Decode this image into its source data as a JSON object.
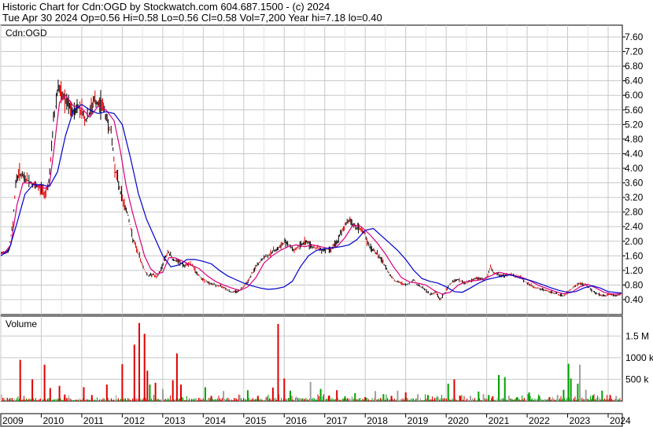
{
  "header": {
    "line1": "Historic Chart for Cdn:OGD by Stockwatch.com 604.687.1500 - (c) 2024",
    "line2": "Tue Apr 30 2024  Op=0.56  Hi=0.58  Lo=0.56  Cl=0.58  Vol=7,200  Year hi=7.18  lo=0.40"
  },
  "colors": {
    "price_black": "#000000",
    "price_red": "#e00000",
    "ma_short": "#d8007f",
    "ma_long": "#0000cc",
    "vol_up": "#00a000",
    "vol_down": "#e00000",
    "vol_flat": "#a0a0a0",
    "grid": "#c8c8c8"
  },
  "chart_data": [
    {
      "type": "line",
      "label": "Cdn:OGD",
      "ylim": [
        0.2,
        7.7
      ],
      "y_ticks": [
        "7.60",
        "7.20",
        "6.80",
        "6.40",
        "6.00",
        "5.60",
        "5.20",
        "4.80",
        "4.40",
        "4.00",
        "3.60",
        "3.20",
        "2.80",
        "2.40",
        "2.00",
        "1.60",
        "1.20",
        "0.80",
        "0.40"
      ],
      "x_ticks": [
        "2009",
        "2010",
        "2011",
        "2012",
        "2013",
        "2014",
        "2015",
        "2016",
        "2017",
        "2018",
        "2019",
        "2020",
        "2021",
        "2022",
        "2023",
        "2024"
      ],
      "x_range": [
        2009.0,
        2024.35
      ],
      "grid": true,
      "series": [
        {
          "name": "",
          "role": "price",
          "x": [
            2009.0,
            2009.08,
            2009.2,
            2009.3,
            2009.37,
            2009.45,
            2009.55,
            2009.7,
            2009.85,
            2010.0,
            2010.1,
            2010.2,
            2010.3,
            2010.42,
            2010.5,
            2010.55,
            2010.6,
            2010.68,
            2010.78,
            2010.9,
            2011.0,
            2011.1,
            2011.2,
            2011.3,
            2011.4,
            2011.5,
            2011.6,
            2011.72,
            2011.82,
            2011.95,
            2012.05,
            2012.15,
            2012.25,
            2012.35,
            2012.45,
            2012.55,
            2012.65,
            2012.75,
            2012.85,
            2012.95,
            2013.05,
            2013.15,
            2013.25,
            2013.35,
            2013.45,
            2013.55,
            2013.65,
            2013.75,
            2013.85,
            2014.0,
            2014.15,
            2014.3,
            2014.5,
            2014.7,
            2014.9,
            2015.1,
            2015.3,
            2015.5,
            2015.65,
            2015.75,
            2015.85,
            2015.95,
            2016.05,
            2016.15,
            2016.25,
            2016.4,
            2016.55,
            2016.7,
            2016.85,
            2017.0,
            2017.15,
            2017.3,
            2017.45,
            2017.6,
            2017.75,
            2017.9,
            2018.0,
            2018.05,
            2018.15,
            2018.3,
            2018.45,
            2018.6,
            2018.75,
            2018.9,
            2019.0,
            2019.1,
            2019.2,
            2019.3,
            2019.45,
            2019.6,
            2019.75,
            2019.85,
            2019.95,
            2020.05,
            2020.15,
            2020.3,
            2020.45,
            2020.6,
            2020.75,
            2020.9,
            2021.0,
            2021.1,
            2021.15,
            2021.25,
            2021.4,
            2021.55,
            2021.7,
            2021.85,
            2022.0,
            2022.15,
            2022.3,
            2022.45,
            2022.6,
            2022.75,
            2022.9,
            2023.0,
            2023.15,
            2023.3,
            2023.45,
            2023.6,
            2023.75,
            2023.9,
            2024.05,
            2024.2,
            2024.33
          ],
          "values": [
            1.65,
            1.7,
            1.75,
            2.5,
            3.6,
            3.9,
            3.75,
            3.65,
            3.5,
            3.45,
            3.3,
            3.7,
            5.3,
            6.3,
            5.9,
            6.0,
            5.8,
            5.7,
            5.5,
            5.7,
            5.6,
            5.3,
            5.5,
            5.9,
            5.7,
            5.8,
            5.4,
            5.0,
            4.0,
            3.4,
            3.0,
            2.7,
            2.1,
            1.8,
            1.5,
            1.2,
            1.05,
            1.1,
            1.0,
            1.2,
            1.55,
            1.7,
            1.5,
            1.45,
            1.4,
            1.3,
            1.4,
            1.3,
            1.1,
            0.95,
            0.85,
            0.8,
            0.75,
            0.6,
            0.65,
            0.9,
            1.3,
            1.55,
            1.65,
            1.75,
            1.8,
            1.9,
            2.0,
            1.85,
            1.75,
            1.9,
            2.0,
            1.85,
            1.8,
            1.75,
            1.8,
            1.95,
            2.35,
            2.6,
            2.4,
            2.3,
            2.2,
            1.95,
            1.8,
            1.65,
            1.4,
            1.1,
            0.9,
            0.85,
            0.8,
            0.85,
            0.95,
            0.8,
            0.7,
            0.55,
            0.6,
            0.4,
            0.55,
            0.75,
            0.9,
            0.95,
            0.85,
            0.9,
            1.0,
            0.95,
            1.0,
            1.3,
            1.15,
            1.1,
            1.05,
            1.1,
            1.05,
            1.0,
            0.85,
            0.75,
            0.7,
            0.65,
            0.6,
            0.55,
            0.5,
            0.6,
            0.75,
            0.85,
            0.8,
            0.65,
            0.55,
            0.5,
            0.55,
            0.5,
            0.58
          ]
        },
        {
          "name": "",
          "role": "short-ma",
          "x": [
            2009.0,
            2009.1,
            2009.25,
            2009.4,
            2009.55,
            2009.75,
            2009.95,
            2010.1,
            2010.2,
            2010.3,
            2010.45,
            2010.6,
            2010.8,
            2011.0,
            2011.2,
            2011.4,
            2011.6,
            2011.8,
            2011.95,
            2012.1,
            2012.25,
            2012.4,
            2012.55,
            2012.7,
            2012.85,
            2013.0,
            2013.15,
            2013.3,
            2013.5,
            2013.7,
            2013.9,
            2014.1,
            2014.3,
            2014.5,
            2014.7,
            2014.9,
            2015.1,
            2015.3,
            2015.5,
            2015.7,
            2015.9,
            2016.1,
            2016.3,
            2016.5,
            2016.7,
            2016.9,
            2017.1,
            2017.3,
            2017.5,
            2017.7,
            2017.9,
            2018.1,
            2018.3,
            2018.5,
            2018.7,
            2018.9,
            2019.1,
            2019.3,
            2019.5,
            2019.7,
            2019.9,
            2020.1,
            2020.3,
            2020.5,
            2020.7,
            2020.9,
            2021.1,
            2021.3,
            2021.5,
            2021.7,
            2021.9,
            2022.1,
            2022.3,
            2022.5,
            2022.7,
            2022.9,
            2023.1,
            2023.3,
            2023.5,
            2023.7,
            2023.9,
            2024.1,
            2024.33
          ],
          "values": [
            1.65,
            1.7,
            1.9,
            3.0,
            3.6,
            3.6,
            3.5,
            3.45,
            3.55,
            4.4,
            5.8,
            6.0,
            5.7,
            5.65,
            5.4,
            5.7,
            5.6,
            5.3,
            4.5,
            3.5,
            2.8,
            2.2,
            1.6,
            1.25,
            1.1,
            1.15,
            1.55,
            1.55,
            1.45,
            1.35,
            1.25,
            1.05,
            0.9,
            0.8,
            0.72,
            0.65,
            0.75,
            1.0,
            1.4,
            1.6,
            1.75,
            1.85,
            1.9,
            1.85,
            1.9,
            1.85,
            1.8,
            1.85,
            2.1,
            2.45,
            2.4,
            2.2,
            1.95,
            1.65,
            1.3,
            1.0,
            0.88,
            0.85,
            0.8,
            0.65,
            0.55,
            0.6,
            0.8,
            0.9,
            0.92,
            0.95,
            1.05,
            1.15,
            1.1,
            1.05,
            1.0,
            0.9,
            0.78,
            0.7,
            0.62,
            0.56,
            0.6,
            0.75,
            0.82,
            0.72,
            0.6,
            0.55,
            0.56
          ]
        },
        {
          "name": "",
          "role": "long-ma",
          "x": [
            2009.0,
            2009.2,
            2009.4,
            2009.6,
            2009.8,
            2010.0,
            2010.2,
            2010.4,
            2010.6,
            2010.8,
            2011.0,
            2011.2,
            2011.4,
            2011.6,
            2011.8,
            2012.0,
            2012.2,
            2012.4,
            2012.6,
            2012.8,
            2013.0,
            2013.2,
            2013.4,
            2013.6,
            2013.8,
            2014.0,
            2014.2,
            2014.4,
            2014.6,
            2014.8,
            2015.0,
            2015.2,
            2015.4,
            2015.6,
            2015.8,
            2016.0,
            2016.2,
            2016.4,
            2016.6,
            2016.8,
            2017.0,
            2017.2,
            2017.4,
            2017.6,
            2017.8,
            2018.0,
            2018.2,
            2018.4,
            2018.6,
            2018.8,
            2019.0,
            2019.2,
            2019.4,
            2019.6,
            2019.8,
            2020.0,
            2020.2,
            2020.4,
            2020.6,
            2020.8,
            2021.0,
            2021.2,
            2021.4,
            2021.6,
            2021.8,
            2022.0,
            2022.2,
            2022.4,
            2022.6,
            2022.8,
            2023.0,
            2023.2,
            2023.4,
            2023.6,
            2023.8,
            2024.0,
            2024.33
          ],
          "values": [
            1.6,
            1.75,
            2.5,
            3.3,
            3.55,
            3.55,
            3.5,
            3.9,
            4.9,
            5.6,
            5.75,
            5.6,
            5.5,
            5.55,
            5.5,
            5.2,
            4.3,
            3.3,
            2.6,
            2.1,
            1.6,
            1.3,
            1.35,
            1.5,
            1.5,
            1.45,
            1.38,
            1.2,
            1.05,
            0.95,
            0.85,
            0.78,
            0.72,
            0.68,
            0.7,
            0.75,
            0.9,
            1.3,
            1.6,
            1.75,
            1.8,
            1.82,
            1.85,
            1.9,
            2.05,
            2.3,
            2.35,
            2.15,
            1.95,
            1.75,
            1.5,
            1.2,
            0.98,
            0.9,
            0.85,
            0.75,
            0.62,
            0.6,
            0.72,
            0.85,
            0.95,
            1.0,
            1.05,
            1.08,
            1.0,
            0.95,
            0.88,
            0.8,
            0.72,
            0.65,
            0.6,
            0.62,
            0.72,
            0.78,
            0.72,
            0.62,
            0.58
          ]
        }
      ]
    },
    {
      "type": "bar",
      "label": "Volume",
      "y_ticks": [
        "1.5 M",
        "1000 k",
        "500 k"
      ],
      "tick_values": [
        1500000,
        1000000,
        500000
      ],
      "ylim": [
        0,
        1850000
      ],
      "x_range": [
        2009.0,
        2024.35
      ],
      "grid": true,
      "spikes": {
        "x": [
          2009.48,
          2009.78,
          2010.08,
          2010.22,
          2010.45,
          2010.58,
          2011.05,
          2011.25,
          2011.62,
          2012.0,
          2012.3,
          2012.42,
          2012.55,
          2012.62,
          2012.68,
          2012.82,
          2013.0,
          2013.25,
          2013.35,
          2013.45,
          2014.05,
          2014.2,
          2014.5,
          2014.9,
          2015.1,
          2015.35,
          2015.55,
          2015.72,
          2015.85,
          2016.0,
          2016.15,
          2016.3,
          2016.65,
          2016.9,
          2017.1,
          2017.3,
          2017.5,
          2017.75,
          2018.0,
          2018.25,
          2018.45,
          2018.65,
          2018.8,
          2019.0,
          2019.3,
          2019.55,
          2019.8,
          2020.05,
          2020.2,
          2020.35,
          2020.6,
          2020.8,
          2020.92,
          2021.05,
          2021.15,
          2021.3,
          2021.45,
          2021.55,
          2021.75,
          2022.05,
          2022.3,
          2022.55,
          2022.75,
          2022.9,
          2023.02,
          2023.08,
          2023.25,
          2023.3,
          2023.45,
          2023.62,
          2023.85,
          2024.05,
          2024.2
        ],
        "values": [
          950000,
          500000,
          840000,
          300000,
          350000,
          150000,
          320000,
          140000,
          380000,
          850000,
          1300000,
          1800000,
          1550000,
          700000,
          380000,
          420000,
          280000,
          480000,
          1100000,
          380000,
          320000,
          120000,
          230000,
          140000,
          250000,
          120000,
          80000,
          310000,
          1780000,
          520000,
          240000,
          100000,
          440000,
          280000,
          120000,
          250000,
          110000,
          180000,
          90000,
          230000,
          160000,
          120000,
          240000,
          200000,
          160000,
          140000,
          90000,
          400000,
          500000,
          120000,
          120000,
          220000,
          160000,
          140000,
          110000,
          600000,
          550000,
          120000,
          90000,
          200000,
          120000,
          90000,
          140000,
          260000,
          860000,
          520000,
          400000,
          840000,
          260000,
          130000,
          240000,
          140000,
          120000
        ],
        "colors": [
          "red",
          "red",
          "red",
          "red",
          "red",
          "red",
          "red",
          "red",
          "red",
          "red",
          "red",
          "red",
          "red",
          "red",
          "green",
          "red",
          "gray",
          "red",
          "red",
          "red",
          "green",
          "red",
          "gray",
          "gray",
          "green",
          "red",
          "gray",
          "red",
          "red",
          "red",
          "green",
          "gray",
          "gray",
          "green",
          "red",
          "red",
          "green",
          "green",
          "red",
          "gray",
          "green",
          "red",
          "gray",
          "red",
          "gray",
          "green",
          "gray",
          "green",
          "red",
          "red",
          "gray",
          "green",
          "gray",
          "green",
          "red",
          "green",
          "green",
          "gray",
          "green",
          "green",
          "green",
          "red",
          "gray",
          "green",
          "green",
          "green",
          "green",
          "gray",
          "gray",
          "green",
          "green",
          "red",
          "gray"
        ]
      }
    }
  ]
}
